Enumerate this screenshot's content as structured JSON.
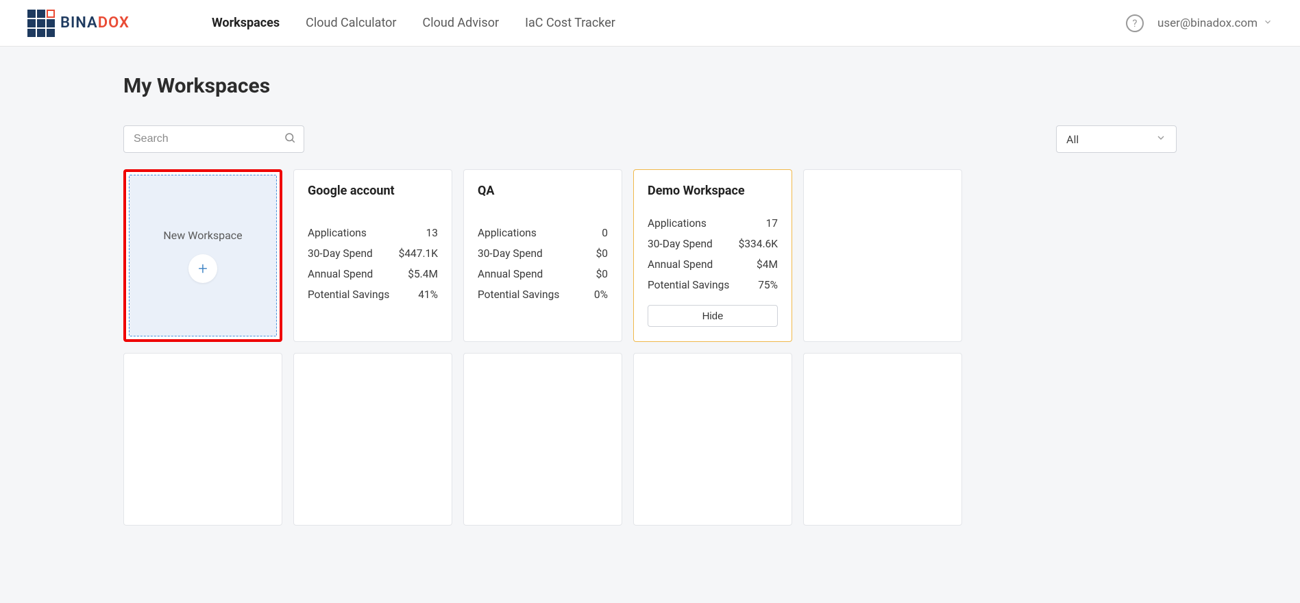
{
  "brand": {
    "name_part1": "BINA",
    "name_part2": "DOX"
  },
  "nav": {
    "items": [
      "Workspaces",
      "Cloud Calculator",
      "Cloud Advisor",
      "IaC Cost Tracker"
    ],
    "active_index": 0
  },
  "header": {
    "user_email": "user@binadox.com"
  },
  "page": {
    "title": "My Workspaces"
  },
  "search": {
    "placeholder": "Search",
    "value": ""
  },
  "filter": {
    "selected": "All"
  },
  "new_workspace": {
    "label": "New Workspace"
  },
  "stat_labels": {
    "applications": "Applications",
    "spend30": "30-Day Spend",
    "annual": "Annual Spend",
    "savings": "Potential Savings"
  },
  "hide_button_label": "Hide",
  "workspaces": [
    {
      "name": "Google account",
      "applications": "13",
      "spend30": "$447.1K",
      "annual": "$5.4M",
      "savings": "41%",
      "active": false
    },
    {
      "name": "QA",
      "applications": "0",
      "spend30": "$0",
      "annual": "$0",
      "savings": "0%",
      "active": false
    },
    {
      "name": "Demo Workspace",
      "applications": "17",
      "spend30": "$334.6K",
      "annual": "$4M",
      "savings": "75%",
      "active": true
    }
  ]
}
